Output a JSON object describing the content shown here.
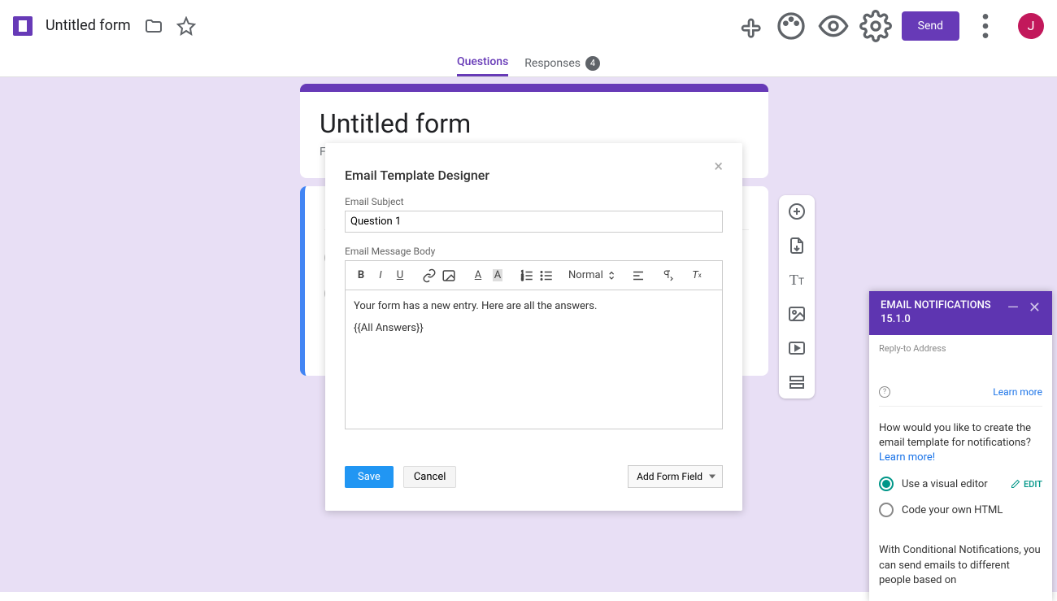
{
  "header": {
    "title": "Untitled form",
    "send_label": "Send",
    "avatar_letter": "J"
  },
  "tabs": {
    "questions": "Questions",
    "responses": "Responses",
    "responses_count": "4"
  },
  "form": {
    "title": "Untitled form",
    "description_placeholder": "Fo"
  },
  "modal": {
    "title": "Email Template Designer",
    "subject_label": "Email Subject",
    "subject_value": "Question 1",
    "body_label": "Email Message Body",
    "body_line1": "Your form has a new entry. Here are all the answers.",
    "body_line2": "{{All Answers}}",
    "format_normal": "Normal",
    "save": "Save",
    "cancel": "Cancel",
    "add_field": "Add Form Field"
  },
  "sidepanel": {
    "title_line1": "EMAIL NOTIFICATIONS",
    "title_line2": "15.1.0",
    "reply_label": "Reply-to Address",
    "learn_more": "Learn more",
    "question": "How would you like to create the email template for notifications?",
    "learn_more_link": "Learn more!",
    "opt_visual": "Use a visual editor",
    "edit_label": "EDIT",
    "opt_html": "Code your own HTML",
    "footer": "With Conditional Notifications, you can send emails to different people based on"
  }
}
